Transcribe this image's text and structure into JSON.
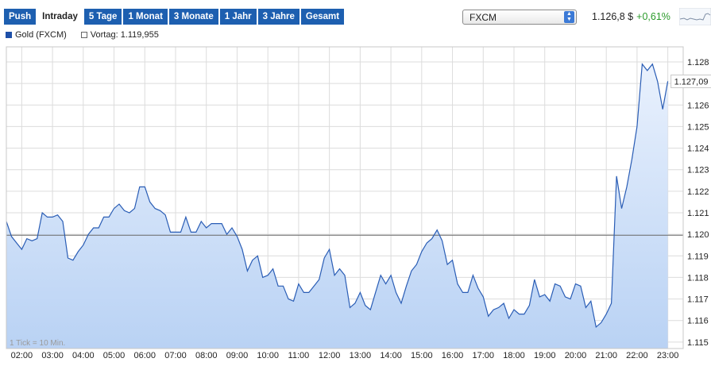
{
  "tabs": [
    {
      "label": "Push",
      "active": false
    },
    {
      "label": "Intraday",
      "active": true
    },
    {
      "label": "5 Tage",
      "active": false
    },
    {
      "label": "1 Monat",
      "active": false
    },
    {
      "label": "3 Monate",
      "active": false
    },
    {
      "label": "1 Jahr",
      "active": false
    },
    {
      "label": "3 Jahre",
      "active": false
    },
    {
      "label": "Gesamt",
      "active": false
    }
  ],
  "market_select": {
    "value": "FXCM"
  },
  "quote": {
    "price": "1.126,8 $",
    "change": "+0,61%",
    "change_color": "#2a9a2a"
  },
  "legend": {
    "series": "Gold (FXCM)",
    "previous": "Vortag: 1.119,955"
  },
  "tick_note": "1 Tick = 10 Min.",
  "last_value_label": "1.127,09",
  "colors": {
    "accent": "#1d5fb0",
    "line": "#2a5db5",
    "fill_top": "#e9f1fd",
    "fill_bottom": "#b9d2f4"
  },
  "chart_data": {
    "type": "area",
    "x_label_unit": "time",
    "xlim": [
      "01:30",
      "23:30"
    ],
    "ylim": [
      1.1147,
      1.1287
    ],
    "y_ticks": [
      1.128,
      1.127,
      1.126,
      1.125,
      1.124,
      1.123,
      1.122,
      1.121,
      1.12,
      1.119,
      1.118,
      1.117,
      1.116,
      1.115
    ],
    "y_tick_labels": [
      "1.128",
      "1.127",
      "1.126",
      "1.125",
      "1.124",
      "1.123",
      "1.122",
      "1.121",
      "1.120",
      "1.119",
      "1.118",
      "1.117",
      "1.116",
      "1.115"
    ],
    "x_ticks": [
      "02:00",
      "03:00",
      "04:00",
      "05:00",
      "06:00",
      "07:00",
      "08:00",
      "09:00",
      "10:00",
      "11:00",
      "12:00",
      "13:00",
      "14:00",
      "15:00",
      "16:00",
      "17:00",
      "18:00",
      "19:00",
      "20:00",
      "21:00",
      "22:00",
      "23:00"
    ],
    "reference_line": {
      "name": "Vortag",
      "value": 1.11996
    },
    "grid": true,
    "series": [
      {
        "name": "Gold (FXCM)",
        "points": [
          [
            "01:30",
            1.1206
          ],
          [
            "01:40",
            1.1199
          ],
          [
            "01:50",
            1.1196
          ],
          [
            "02:00",
            1.1193
          ],
          [
            "02:10",
            1.1198
          ],
          [
            "02:20",
            1.1197
          ],
          [
            "02:30",
            1.1198
          ],
          [
            "02:40",
            1.121
          ],
          [
            "02:50",
            1.1208
          ],
          [
            "03:00",
            1.1208
          ],
          [
            "03:10",
            1.1209
          ],
          [
            "03:20",
            1.1206
          ],
          [
            "03:30",
            1.1189
          ],
          [
            "03:40",
            1.1188
          ],
          [
            "03:50",
            1.1192
          ],
          [
            "04:00",
            1.1195
          ],
          [
            "04:10",
            1.12
          ],
          [
            "04:20",
            1.1203
          ],
          [
            "04:30",
            1.1203
          ],
          [
            "04:40",
            1.1208
          ],
          [
            "04:50",
            1.1208
          ],
          [
            "05:00",
            1.1212
          ],
          [
            "05:10",
            1.1214
          ],
          [
            "05:20",
            1.1211
          ],
          [
            "05:30",
            1.121
          ],
          [
            "05:40",
            1.1212
          ],
          [
            "05:50",
            1.1222
          ],
          [
            "06:00",
            1.1222
          ],
          [
            "06:10",
            1.1215
          ],
          [
            "06:20",
            1.1212
          ],
          [
            "06:30",
            1.1211
          ],
          [
            "06:40",
            1.1209
          ],
          [
            "06:50",
            1.1201
          ],
          [
            "07:00",
            1.1201
          ],
          [
            "07:10",
            1.1201
          ],
          [
            "07:20",
            1.1208
          ],
          [
            "07:30",
            1.1201
          ],
          [
            "07:40",
            1.1201
          ],
          [
            "07:50",
            1.1206
          ],
          [
            "08:00",
            1.1203
          ],
          [
            "08:10",
            1.1205
          ],
          [
            "08:20",
            1.1205
          ],
          [
            "08:30",
            1.1205
          ],
          [
            "08:40",
            1.12
          ],
          [
            "08:50",
            1.1203
          ],
          [
            "09:00",
            1.1199
          ],
          [
            "09:10",
            1.1193
          ],
          [
            "09:20",
            1.1183
          ],
          [
            "09:30",
            1.1188
          ],
          [
            "09:40",
            1.119
          ],
          [
            "09:50",
            1.118
          ],
          [
            "10:00",
            1.1181
          ],
          [
            "10:10",
            1.1184
          ],
          [
            "10:20",
            1.1176
          ],
          [
            "10:30",
            1.1176
          ],
          [
            "10:40",
            1.117
          ],
          [
            "10:50",
            1.1169
          ],
          [
            "11:00",
            1.1177
          ],
          [
            "11:10",
            1.1173
          ],
          [
            "11:20",
            1.1173
          ],
          [
            "11:30",
            1.1176
          ],
          [
            "11:40",
            1.1179
          ],
          [
            "11:50",
            1.1189
          ],
          [
            "12:00",
            1.1193
          ],
          [
            "12:10",
            1.1181
          ],
          [
            "12:20",
            1.1184
          ],
          [
            "12:30",
            1.1181
          ],
          [
            "12:40",
            1.1166
          ],
          [
            "12:50",
            1.1168
          ],
          [
            "13:00",
            1.1173
          ],
          [
            "13:10",
            1.1167
          ],
          [
            "13:20",
            1.1165
          ],
          [
            "13:30",
            1.1173
          ],
          [
            "13:40",
            1.1181
          ],
          [
            "13:50",
            1.1177
          ],
          [
            "14:00",
            1.1181
          ],
          [
            "14:10",
            1.1173
          ],
          [
            "14:20",
            1.1168
          ],
          [
            "14:30",
            1.1176
          ],
          [
            "14:40",
            1.1183
          ],
          [
            "14:50",
            1.1186
          ],
          [
            "15:00",
            1.1192
          ],
          [
            "15:10",
            1.1196
          ],
          [
            "15:20",
            1.1198
          ],
          [
            "15:30",
            1.1202
          ],
          [
            "15:40",
            1.1197
          ],
          [
            "15:50",
            1.1186
          ],
          [
            "16:00",
            1.1188
          ],
          [
            "16:10",
            1.1177
          ],
          [
            "16:20",
            1.1173
          ],
          [
            "16:30",
            1.1173
          ],
          [
            "16:40",
            1.1181
          ],
          [
            "16:50",
            1.1175
          ],
          [
            "17:00",
            1.1171
          ],
          [
            "17:10",
            1.1162
          ],
          [
            "17:20",
            1.1165
          ],
          [
            "17:30",
            1.1166
          ],
          [
            "17:40",
            1.1168
          ],
          [
            "17:50",
            1.1161
          ],
          [
            "18:00",
            1.1165
          ],
          [
            "18:10",
            1.1163
          ],
          [
            "18:20",
            1.1163
          ],
          [
            "18:30",
            1.1167
          ],
          [
            "18:40",
            1.1179
          ],
          [
            "18:50",
            1.1171
          ],
          [
            "19:00",
            1.1172
          ],
          [
            "19:10",
            1.1169
          ],
          [
            "19:20",
            1.1177
          ],
          [
            "19:30",
            1.1176
          ],
          [
            "19:40",
            1.1171
          ],
          [
            "19:50",
            1.117
          ],
          [
            "20:00",
            1.1177
          ],
          [
            "20:10",
            1.1176
          ],
          [
            "20:20",
            1.1166
          ],
          [
            "20:30",
            1.1169
          ],
          [
            "20:40",
            1.1157
          ],
          [
            "20:50",
            1.1159
          ],
          [
            "21:00",
            1.1163
          ],
          [
            "21:10",
            1.1168
          ],
          [
            "21:20",
            1.1227
          ],
          [
            "21:30",
            1.1212
          ],
          [
            "21:40",
            1.1222
          ],
          [
            "21:50",
            1.1235
          ],
          [
            "22:00",
            1.125
          ],
          [
            "22:10",
            1.1279
          ],
          [
            "22:20",
            1.1276
          ],
          [
            "22:30",
            1.1279
          ],
          [
            "22:40",
            1.1271
          ],
          [
            "22:50",
            1.1258
          ],
          [
            "23:00",
            1.1271
          ]
        ]
      }
    ]
  }
}
